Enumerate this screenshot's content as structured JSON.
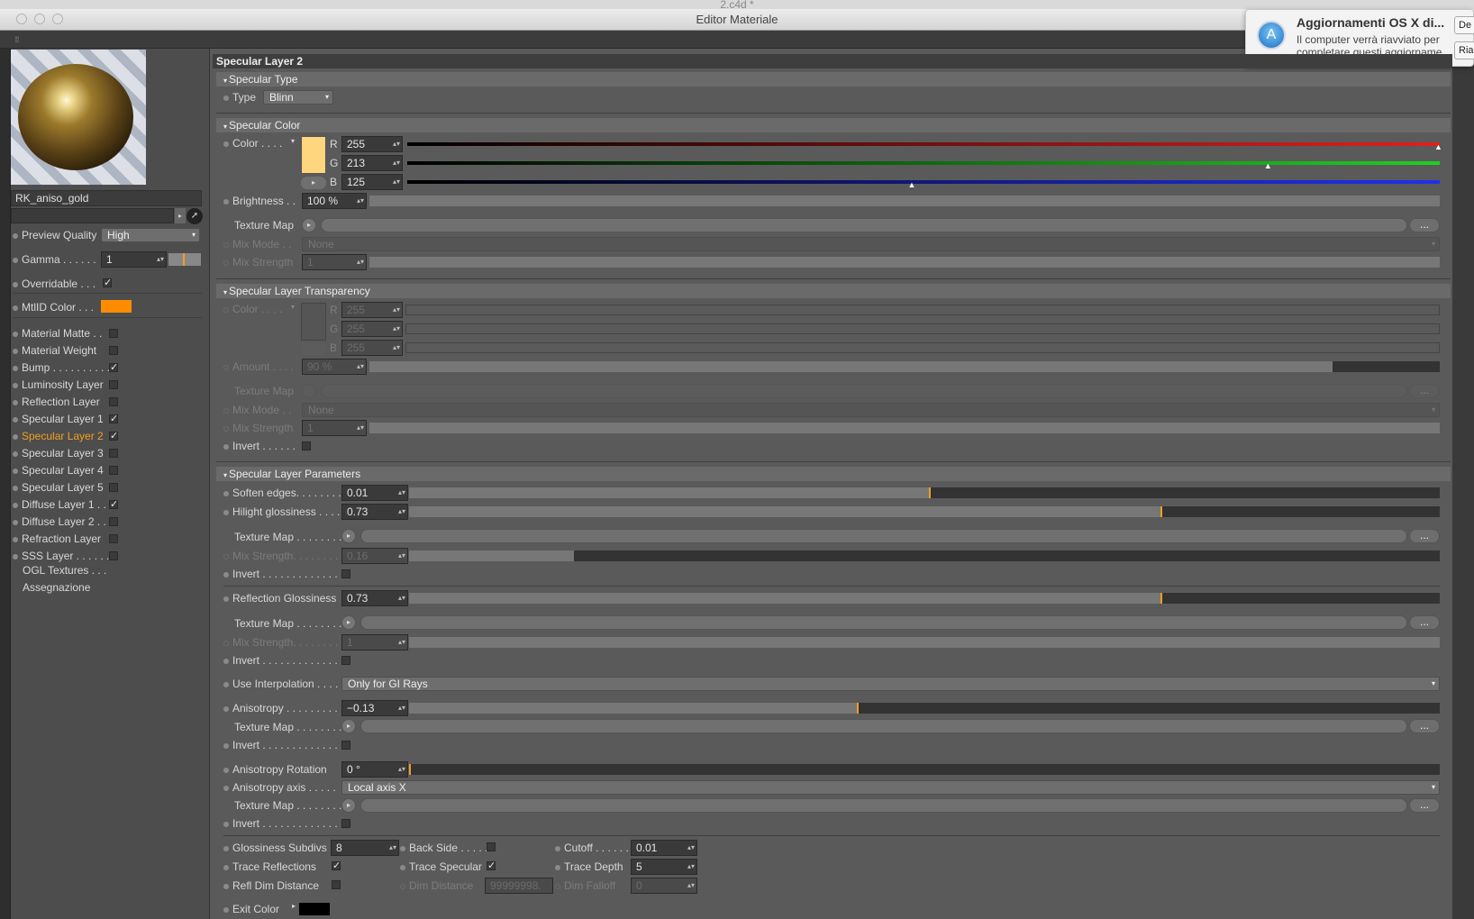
{
  "window": {
    "title": "Editor Materiale",
    "behind_title": "2.c4d *"
  },
  "notification": {
    "title": "Aggiornamenti OS X di...",
    "body": "Il computer verrà riavviato per completare questi aggiorname...",
    "buttons": [
      "De",
      "Ria"
    ]
  },
  "material": {
    "name": "RK_aniso_gold"
  },
  "left": {
    "preview_quality": {
      "label": "Preview Quality",
      "value": "High"
    },
    "gamma": {
      "label": "Gamma . . . . . .",
      "value": "1"
    },
    "overridable": {
      "label": "Overridable . . .",
      "checked": true
    },
    "mtlid": {
      "label": "MtlID Color . . .",
      "color": "#ff8c00"
    },
    "channels": [
      {
        "label": "Material Matte . .",
        "checked": false
      },
      {
        "label": "Material Weight",
        "checked": false
      },
      {
        "label": "Bump . . . . . . . . . .",
        "checked": true
      },
      {
        "label": "Luminosity Layer",
        "checked": false
      },
      {
        "label": "Reflection Layer",
        "checked": false
      },
      {
        "label": "Specular Layer 1",
        "checked": true
      },
      {
        "label": "Specular Layer 2",
        "checked": true,
        "active": true
      },
      {
        "label": "Specular Layer 3",
        "checked": false
      },
      {
        "label": "Specular Layer 4",
        "checked": false
      },
      {
        "label": "Specular Layer 5",
        "checked": false
      },
      {
        "label": "Diffuse Layer 1 . .",
        "checked": true
      },
      {
        "label": "Diffuse Layer 2 . .",
        "checked": false
      },
      {
        "label": "Refraction Layer",
        "checked": false
      },
      {
        "label": "SSS Layer . . . . . .",
        "checked": false
      }
    ],
    "extra": [
      "OGL Textures . . .",
      "Assegnazione"
    ],
    "active_color": "#f0a020"
  },
  "panel": {
    "title": "Specular Layer 2",
    "spec_type": {
      "header": "Specular Type",
      "label": "Type",
      "value": "Blinn"
    },
    "spec_color": {
      "header": "Specular Color",
      "color_label": "Color . . . .",
      "r": {
        "label": "R",
        "value": "255",
        "level": 1.0
      },
      "g": {
        "label": "G",
        "value": "213",
        "level": 0.835
      },
      "b": {
        "label": "B",
        "value": "125",
        "level": 0.49
      },
      "swatch": "#ffd57d",
      "brightness": {
        "label": "Brightness . .",
        "value": "100 %",
        "level": 1.0
      },
      "texture_map": "Texture Map",
      "mix_mode": {
        "label": "Mix Mode . .",
        "value": "None"
      },
      "mix_strength": {
        "label": "Mix Strength",
        "value": "1"
      }
    },
    "transparency": {
      "header": "Specular Layer Transparency",
      "color_label": "Color . . . .",
      "r": {
        "label": "R",
        "value": "255"
      },
      "g": {
        "label": "G",
        "value": "255"
      },
      "b": {
        "label": "B",
        "value": "255"
      },
      "amount": {
        "label": "Amount . . . .",
        "value": "90 %",
        "level": 0.9
      },
      "texture_map": "Texture Map",
      "mix_mode": {
        "label": "Mix Mode . .",
        "value": "None"
      },
      "mix_strength": {
        "label": "Mix Strength",
        "value": "1"
      },
      "invert": "Invert . . . . . ."
    },
    "params": {
      "header": "Specular Layer Parameters",
      "soften": {
        "label": "Soften edges. . . . . . . .",
        "value": "0.01",
        "level": 0.505
      },
      "hilight": {
        "label": "Hilight glossiness . . . .",
        "value": "0.73",
        "level": 0.73
      },
      "tm1": "Texture Map . . . . . . . .",
      "mix1": {
        "label": "Mix Strength. . . . . . . .",
        "value": "0.16",
        "level": 0.16
      },
      "invert1": "Invert . . . . . . . . . . . . . .",
      "refl_gloss": {
        "label": "Reflection Glossiness",
        "value": "0.73",
        "level": 0.73
      },
      "tm2": "Texture Map . . . . . . . .",
      "mix2": {
        "label": "Mix Strength. . . . . . . .",
        "value": "1"
      },
      "invert2": "Invert . . . . . . . . . . . . . .",
      "interp": {
        "label": "Use Interpolation . . . .",
        "value": "Only for GI Rays"
      },
      "aniso": {
        "label": "Anisotropy . . . . . . . . . .",
        "value": "−0.13",
        "level": 0.435
      },
      "tm3": "Texture Map . . . . . . . .",
      "invert3": "Invert . . . . . . . . . . . . . .",
      "aniso_rot": {
        "label": "Anisotropy Rotation",
        "value": "0 °",
        "level": 0.0
      },
      "aniso_axis": {
        "label": "Anisotropy axis . . . . .",
        "value": "Local axis X"
      },
      "tm4": "Texture Map . . . . . . . .",
      "invert4": "Invert . . . . . . . . . . . . . .",
      "gloss_subdivs": {
        "label": "Glossiness Subdivs",
        "value": "8"
      },
      "back_side": {
        "label": "Back Side . . . . .",
        "checked": false
      },
      "cutoff": {
        "label": "Cutoff . . . . . .",
        "value": "0.01"
      },
      "trace_refl": {
        "label": "Trace Reflections",
        "checked": true
      },
      "trace_spec": {
        "label": "Trace Specular",
        "checked": true
      },
      "trace_depth": {
        "label": "Trace Depth",
        "value": "5"
      },
      "refl_dim": {
        "label": "Refl Dim Distance",
        "checked": false
      },
      "dim_distance": {
        "label": "Dim Distance",
        "value": "99999998."
      },
      "dim_falloff": {
        "label": "Dim Falloff",
        "value": "0"
      },
      "exit_color": {
        "label": "Exit Color",
        "color": "#000000"
      }
    }
  },
  "ui": {
    "check": "✓",
    "tri": "▾",
    "arrow": "▸",
    "spin": "▴▾",
    "more": "..."
  }
}
